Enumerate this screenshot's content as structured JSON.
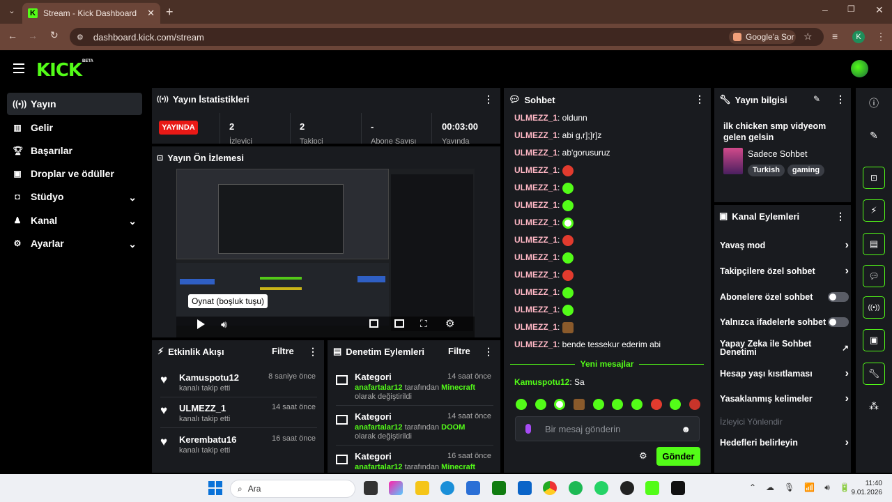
{
  "browser": {
    "tab_title": "Stream - Kick Dashboard",
    "url": "dashboard.kick.com/stream",
    "ask_google": "Google'a Sor",
    "profile_letter": "K"
  },
  "sidebar": {
    "logo": "KICK",
    "beta": "BETA",
    "items": [
      {
        "label": "Yayın",
        "icon": "broadcast-icon"
      },
      {
        "label": "Gelir",
        "icon": "chart-icon"
      },
      {
        "label": "Başarılar",
        "icon": "trophy-icon"
      },
      {
        "label": "Droplar ve ödüller",
        "icon": "gift-icon"
      },
      {
        "label": "Stüdyo",
        "icon": "studio-icon"
      },
      {
        "label": "Kanal",
        "icon": "person-icon"
      },
      {
        "label": "Ayarlar",
        "icon": "gear-icon"
      }
    ]
  },
  "stats": {
    "title": "Yayın İstatistikleri",
    "live": "YAYINDA",
    "values": [
      "2",
      "2",
      "-",
      "00:03:00"
    ],
    "labels": [
      "İzleyici",
      "Takipçi",
      "Abone Sayısı",
      "Yayında"
    ]
  },
  "preview": {
    "title": "Yayın Ön İzlemesi",
    "tooltip": "Oynat (boşluk tuşu)"
  },
  "activity": {
    "title": "Etkinlik Akışı",
    "filter": "Filtre",
    "items": [
      {
        "name": "Kamuspotu12",
        "sub": "kanalı takip etti",
        "time": "8 saniye önce"
      },
      {
        "name": "ULMEZZ_1",
        "sub": "kanalı takip etti",
        "time": "14 saat önce"
      },
      {
        "name": "Kerembatu16",
        "sub": "kanalı takip etti",
        "time": "16 saat önce"
      }
    ]
  },
  "moderation": {
    "title": "Denetim Eylemleri",
    "filter": "Filtre",
    "items": [
      {
        "title": "Kategori",
        "time": "14 saat önce",
        "user": "anafartalar12",
        "by": "tarafından",
        "target": "Minecraft",
        "suffix": "olarak değiştirildi"
      },
      {
        "title": "Kategori",
        "time": "14 saat önce",
        "user": "anafartalar12",
        "by": "tarafından",
        "target": "DOOM",
        "suffix": "olarak değiştirildi"
      },
      {
        "title": "Kategori",
        "time": "16 saat önce",
        "user": "anafartalar12",
        "by": "tarafından",
        "target": "Minecraft",
        "suffix": ""
      }
    ]
  },
  "chat": {
    "title": "Sohbet",
    "messages": [
      {
        "user": "ULMEZZ_1",
        "text": ": oldunn"
      },
      {
        "user": "ULMEZZ_1",
        "text": ": abi g,r];]r]z"
      },
      {
        "user": "ULMEZZ_1",
        "text": ": ab'gorusuruz"
      },
      {
        "user": "ULMEZZ_1",
        "text": ":"
      },
      {
        "user": "ULMEZZ_1",
        "text": ":"
      },
      {
        "user": "ULMEZZ_1",
        "text": ":"
      },
      {
        "user": "ULMEZZ_1",
        "text": ":"
      },
      {
        "user": "ULMEZZ_1",
        "text": ":"
      },
      {
        "user": "ULMEZZ_1",
        "text": ":"
      },
      {
        "user": "ULMEZZ_1",
        "text": ":"
      },
      {
        "user": "ULMEZZ_1",
        "text": ":"
      },
      {
        "user": "ULMEZZ_1",
        "text": ":"
      },
      {
        "user": "ULMEZZ_1",
        "text": ":"
      },
      {
        "user": "ULMEZZ_1",
        "text": ": bende tessekur ederim abi"
      }
    ],
    "new_messages": "Yeni mesajlar",
    "last": {
      "user": "Kamuspotu12",
      "text": ": Sa"
    },
    "placeholder": "Bir mesaj gönderin",
    "send": "Gönder"
  },
  "info": {
    "title": "Yayın bilgisi",
    "stream_title": "ilk chicken smp vidyeom gelen gelsin",
    "category": "Sadece Sohbet",
    "tags": [
      "Turkish",
      "gaming"
    ]
  },
  "channel_actions": {
    "title": "Kanal Eylemleri",
    "items": [
      {
        "label": "Yavaş mod",
        "kind": "chevron"
      },
      {
        "label": "Takipçilere özel sohbet",
        "kind": "chevron"
      },
      {
        "label": "Abonelere özel sohbet",
        "kind": "toggle"
      },
      {
        "label": "Yalnızca ifadelerle sohbet",
        "kind": "toggle"
      },
      {
        "label": "Yapay Zeka ile Sohbet Denetimi",
        "kind": "external"
      },
      {
        "label": "Hesap yaşı kısıtlaması",
        "kind": "chevron"
      },
      {
        "label": "Yasaklanmış kelimeler",
        "kind": "chevron"
      }
    ],
    "section": "İzleyici Yönlendir",
    "goal": "Hedefleri belirleyin"
  },
  "taskbar": {
    "search": "Ara",
    "time": "11:40",
    "date": "9.01.2026"
  },
  "colors": {
    "accent": "#53fc18",
    "live": "#e91916",
    "panel": "#191b1f",
    "username": "#ffb7c5"
  }
}
